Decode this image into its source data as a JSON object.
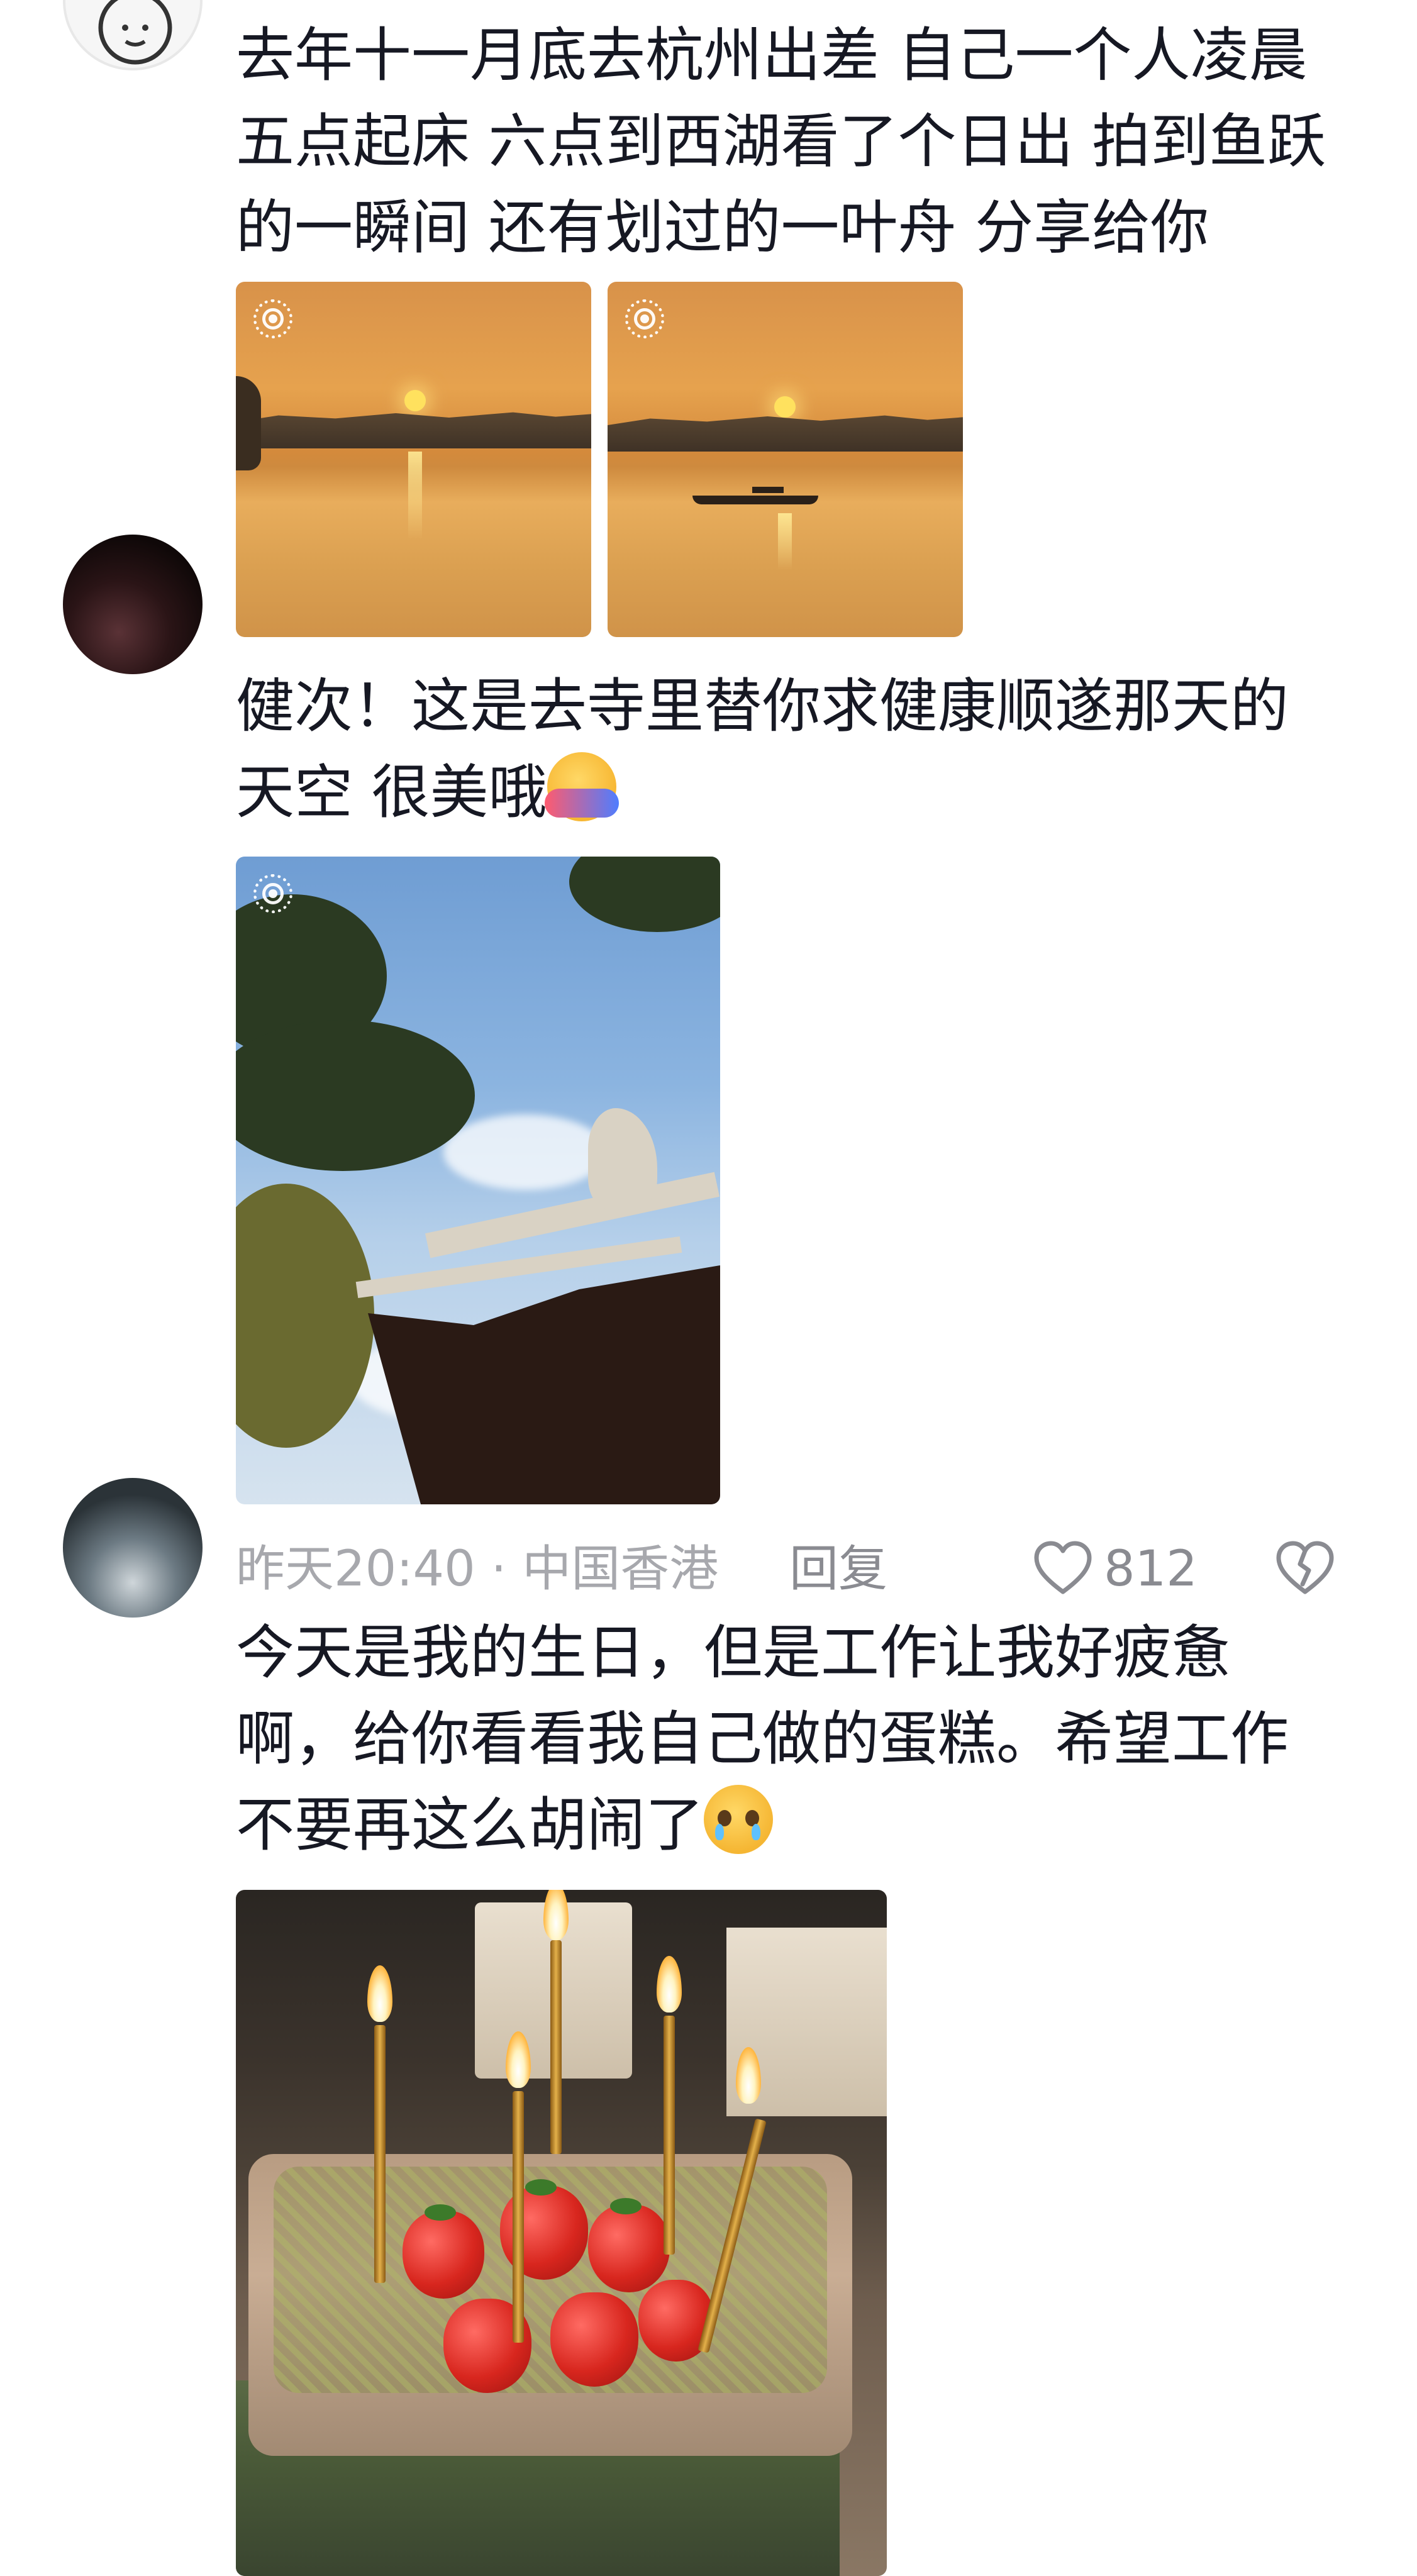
{
  "comments": [
    {
      "lines": [
        "去年十一月底去杭州出差 自己一个人凌晨",
        "五点起床 六点到西湖看了个日出 拍到鱼跃",
        "的一瞬间  还有划过的一叶舟 分享给你"
      ],
      "images": [
        "sunrise-photo",
        "sunrise-boat-photo"
      ]
    },
    {
      "lines": [
        "健次！这是去寺里替你求健康顺遂那天的",
        "天空 很美哦"
      ],
      "emoji": "hugging-face-emoji",
      "images": [
        "temple-roof-photo"
      ],
      "meta": {
        "time": "昨天20:40",
        "separator": "·",
        "location": "中国香港",
        "reply_label": "回复",
        "like_count": "812"
      }
    },
    {
      "lines": [
        "今天是我的生日，但是工作让我好疲惫",
        "啊，给你看看我自己做的蛋糕。希望工作",
        "不要再这么胡闹了"
      ],
      "emoji": "holding-back-tears-emoji",
      "images": [
        "birthday-cake-photo"
      ]
    }
  ],
  "icons": {
    "live_photo": "live-photo-icon",
    "like": "heart-icon",
    "dislike": "broken-heart-icon"
  },
  "colors": {
    "text": "#161823",
    "meta_text": "#a7a8ad",
    "action_text": "#8a8b91"
  }
}
